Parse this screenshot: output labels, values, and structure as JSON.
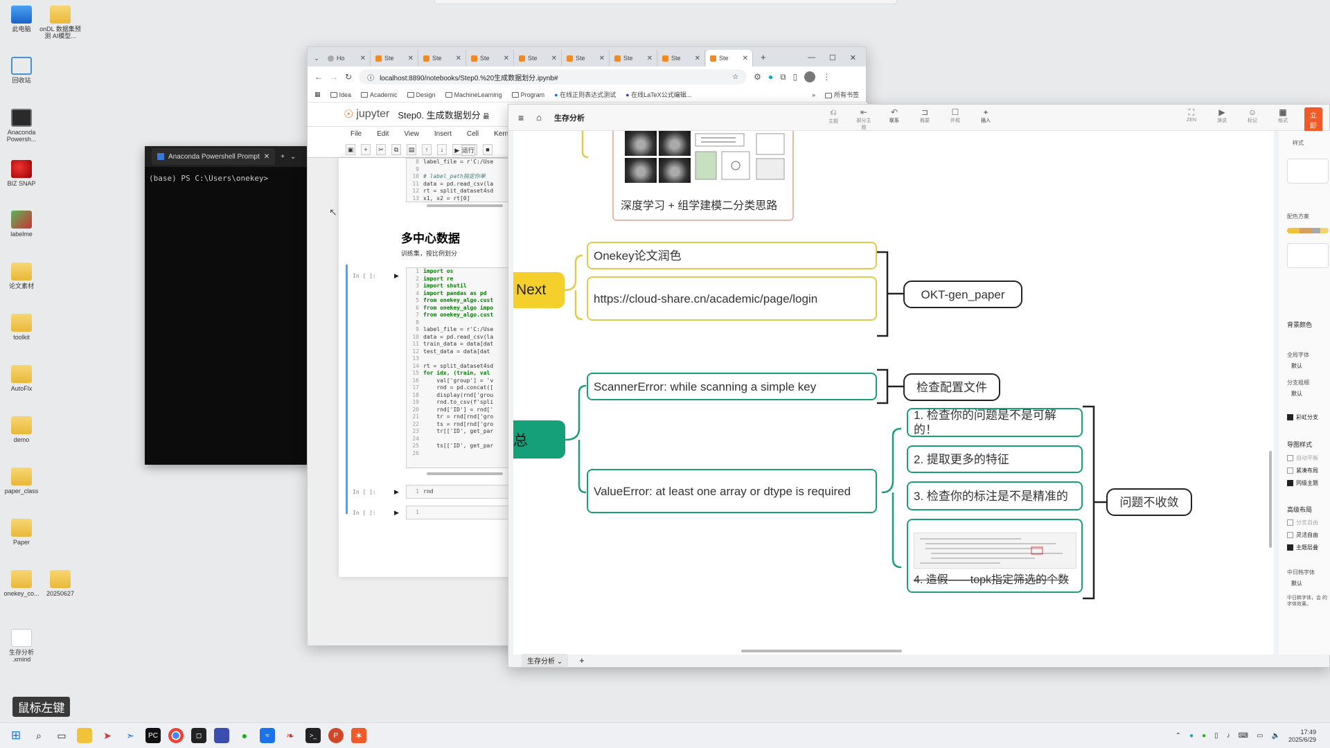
{
  "desktop": {
    "icons": [
      {
        "label": "此电脑",
        "kind": "pc"
      },
      {
        "label": "onDL 数据集预测 AI模型...",
        "kind": "folder"
      },
      {
        "label": "回收站",
        "kind": "recycle"
      },
      {
        "label": "Anaconda Powersh...",
        "kind": "term"
      },
      {
        "label": "BIZ SNAP",
        "kind": "snake"
      },
      {
        "label": "labelme",
        "kind": "label"
      },
      {
        "label": "论文素材",
        "kind": "folder"
      },
      {
        "label": "toolkit",
        "kind": "folder"
      },
      {
        "label": "AutoFlx",
        "kind": "folder"
      },
      {
        "label": "demo",
        "kind": "folder"
      },
      {
        "label": "paper_class",
        "kind": "folder"
      },
      {
        "label": "Paper",
        "kind": "folder"
      },
      {
        "label": "onekey_co...",
        "kind": "folder"
      },
      {
        "label": "20250627",
        "kind": "folder"
      },
      {
        "label": "生存分析 .xmind",
        "kind": "doc"
      }
    ]
  },
  "terminal": {
    "tab_title": "Anaconda Powershell Prompt",
    "prompt": "(base) PS C:\\Users\\onekey>"
  },
  "browser": {
    "tabs": [
      {
        "label": "Ho"
      },
      {
        "label": "Ste"
      },
      {
        "label": "Ste"
      },
      {
        "label": "Ste"
      },
      {
        "label": "Ste"
      },
      {
        "label": "Ste"
      },
      {
        "label": "Ste"
      },
      {
        "label": "Ste"
      },
      {
        "label": "Ste"
      }
    ],
    "new_tab": "+",
    "url": "localhost:8890/notebooks/Step0.%20生成数据划分.ipynb#",
    "bookmarks": [
      "Idea",
      "Academic",
      "Design",
      "MachineLearning",
      "Program",
      "在线正则表达式测试",
      "在线LaTeX公式编辑...",
      "所有书签"
    ]
  },
  "jupyter": {
    "logo": "jupyter",
    "title": "Step0. 生成数据划分",
    "title_suffix": "最",
    "menu": [
      "File",
      "Edit",
      "View",
      "Insert",
      "Cell",
      "Kern"
    ],
    "run_label": "运行",
    "heading": "多中心数据",
    "paragraph": "训练集，按比例划分",
    "in_prompt": "In [ ]:",
    "cell1_lines": [
      {
        "n": "8",
        "t": "label_file = r'C:/Use",
        "c": ""
      },
      {
        "n": "9",
        "t": "",
        "c": ""
      },
      {
        "n": "10",
        "t": "# label_path指定你单",
        "c": "cm"
      },
      {
        "n": "11",
        "t": "data = pd.read_csv(la",
        "c": ""
      },
      {
        "n": "12",
        "t": "rt = split_dataset4sd",
        "c": ""
      },
      {
        "n": "13",
        "t": "x1, x2 = rt[0]",
        "c": ""
      }
    ],
    "cell2_lines": [
      {
        "n": "1",
        "t": "import os",
        "c": "kw"
      },
      {
        "n": "2",
        "t": "import re",
        "c": "kw"
      },
      {
        "n": "3",
        "t": "import shutil",
        "c": "kw"
      },
      {
        "n": "4",
        "t": "import pandas as pd",
        "c": "kw"
      },
      {
        "n": "5",
        "t": "from onekey_algo.cust",
        "c": "kw"
      },
      {
        "n": "6",
        "t": "from onekey_algo impo",
        "c": "kw"
      },
      {
        "n": "7",
        "t": "from onekey_algo.cust",
        "c": "kw"
      },
      {
        "n": "8",
        "t": "",
        "c": ""
      },
      {
        "n": "9",
        "t": "label_file = r'C:/Use",
        "c": ""
      },
      {
        "n": "10",
        "t": "data = pd.read_csv(la",
        "c": ""
      },
      {
        "n": "11",
        "t": "train_data = data[dat",
        "c": ""
      },
      {
        "n": "12",
        "t": "test_data = data[dat",
        "c": ""
      },
      {
        "n": "13",
        "t": "",
        "c": ""
      },
      {
        "n": "14",
        "t": "rt = split_dataset4sd",
        "c": ""
      },
      {
        "n": "15",
        "t": "for idx, (train, val",
        "c": "kw"
      },
      {
        "n": "16",
        "t": "    val['group'] = 'v",
        "c": ""
      },
      {
        "n": "17",
        "t": "    rnd = pd.concat([",
        "c": ""
      },
      {
        "n": "18",
        "t": "    display(rnd['grou",
        "c": ""
      },
      {
        "n": "19",
        "t": "    rnd.to_csv(f'spli",
        "c": ""
      },
      {
        "n": "20",
        "t": "    rnd['ID'] = rnd['",
        "c": ""
      },
      {
        "n": "21",
        "t": "    tr = rnd[rnd['gro",
        "c": ""
      },
      {
        "n": "22",
        "t": "    ts = rnd[rnd['gro",
        "c": ""
      },
      {
        "n": "23",
        "t": "    tr[['ID', get_par",
        "c": ""
      },
      {
        "n": "24",
        "t": "",
        "c": ""
      },
      {
        "n": "25",
        "t": "    ts[['ID', get_par",
        "c": ""
      },
      {
        "n": "26",
        "t": "",
        "c": ""
      }
    ],
    "cell3_line": {
      "n": "1",
      "t": "rnd"
    },
    "cell4_line": {
      "n": "1",
      "t": ""
    }
  },
  "mindmap": {
    "doc_title": "生存分析",
    "tools": [
      {
        "icon": "⎌",
        "label": "主题"
      },
      {
        "icon": "⇤",
        "label": "部分主题"
      },
      {
        "icon": "↶",
        "label": "联系"
      },
      {
        "icon": "⊐",
        "label": "概要"
      },
      {
        "icon": "☐",
        "label": "外框"
      },
      {
        "icon": "+",
        "label": "插入"
      }
    ],
    "view_tools": [
      {
        "icon": "⛶",
        "label": "ZEN"
      },
      {
        "icon": "▶",
        "label": "演说"
      },
      {
        "icon": "☺",
        "label": "标记"
      },
      {
        "icon": "▦",
        "label": "格式"
      }
    ],
    "export_label": "立即",
    "thumb_caption": "深度学习 + 组学建模二分类思路",
    "root_next": "Next",
    "root_summary": "汇总",
    "nodes": {
      "polish": "Onekey论文润色",
      "url": "https://cloud-share.cn/academic/page/login",
      "gen_paper": "OKT-gen_paper",
      "scanner": "ScannerError: while scanning a simple key",
      "check_config": "检查配置文件",
      "value_error": "ValueError: at least one array or dtype is required",
      "tip1": "1. 检查你的问题是不是可解的！",
      "tip2": "2. 提取更多的特征",
      "tip3": "3. 检查你的标注是不是精准的",
      "tip4": "4. 造假——topk指定筛选的个数",
      "not_converge": "问题不收敛"
    },
    "sheet_tab": "生存分析",
    "add_sheet": "+",
    "side_panel": {
      "title": "样式",
      "palette": "配色方案",
      "bg_color": "背景颜色",
      "global_font": "全局字体",
      "default1": "默认",
      "branch_thickness": "分支粗细",
      "default2": "默认",
      "rainbow": "彩虹分支",
      "map_style": "导图样式",
      "auto_balance": "自动平衡",
      "compact": "紧凑布局",
      "same_level": "同级主题",
      "advanced_layout": "高级布局",
      "branch_free": "分支自由",
      "flexible": "灵活自由",
      "topic_overlap": "主题层叠",
      "cjk_font": "中日韩字体",
      "default3": "默认",
      "cjk_note": "中日韩字体，会 的字体效果。"
    }
  },
  "mouse_hint": "鼠标左键",
  "taskbar": {
    "time": "17:49",
    "date": "2025/6/29"
  }
}
